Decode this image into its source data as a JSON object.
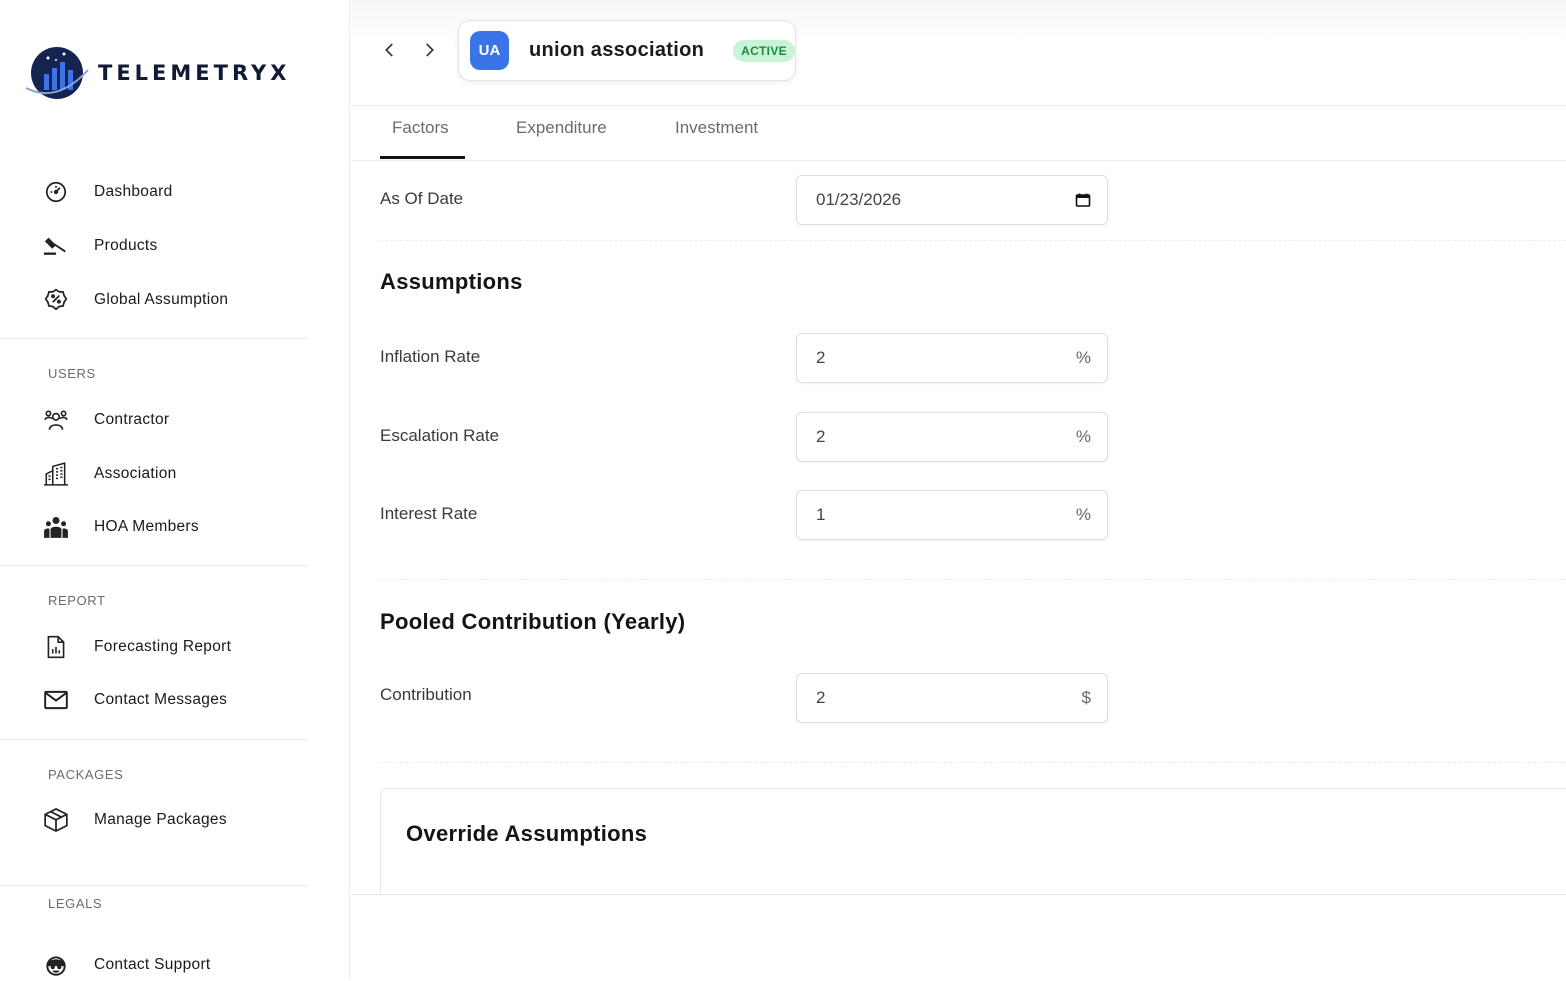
{
  "app": {
    "brand": "TELEMETRYX"
  },
  "sidebar": {
    "main_items": [
      {
        "label": "Dashboard",
        "icon": "dashboard-gauge-icon"
      },
      {
        "label": "Products",
        "icon": "gavel-icon"
      },
      {
        "label": "Global Assumption",
        "icon": "percent-badge-icon"
      }
    ],
    "sections": [
      {
        "title": "USERS",
        "items": [
          {
            "label": "Contractor",
            "icon": "people-group-icon"
          },
          {
            "label": "Association",
            "icon": "building-icon"
          },
          {
            "label": "HOA Members",
            "icon": "members-icon"
          }
        ]
      },
      {
        "title": "REPORT",
        "items": [
          {
            "label": "Forecasting Report",
            "icon": "report-file-icon"
          },
          {
            "label": "Contact Messages",
            "icon": "envelope-icon"
          }
        ]
      },
      {
        "title": "PACKAGES",
        "items": [
          {
            "label": "Manage Packages",
            "icon": "package-box-icon"
          }
        ]
      },
      {
        "title": "LEGALS",
        "items": [
          {
            "label": "Contact Support",
            "icon": "support-agent-icon"
          }
        ]
      }
    ]
  },
  "header": {
    "avatar_initials": "UA",
    "entity_name": "union association",
    "status": "ACTIVE",
    "status_color": "#1f8a43",
    "avatar_color": "#3b74e6"
  },
  "tabs": [
    "Factors",
    "Expenditure",
    "Investment"
  ],
  "active_tab": "Factors",
  "form": {
    "as_of_date": {
      "label": "As Of Date",
      "value": "01/23/2026"
    },
    "assumptions_heading": "Assumptions",
    "inflation_rate": {
      "label": "Inflation Rate",
      "value": "2",
      "unit": "%"
    },
    "escalation_rate": {
      "label": "Escalation Rate",
      "value": "2",
      "unit": "%"
    },
    "interest_rate": {
      "label": "Interest Rate",
      "value": "1",
      "unit": "%"
    },
    "pooled_heading": "Pooled Contribution (Yearly)",
    "contribution": {
      "label": "Contribution",
      "value": "2",
      "unit": "$"
    },
    "override_heading": "Override Assumptions"
  }
}
